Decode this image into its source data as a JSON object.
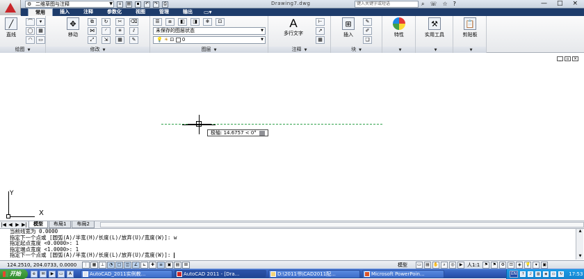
{
  "titlebar": {
    "workspace": "二维草图与注释",
    "doc_title": "Drawing7.dwg",
    "search_placeholder": "键入关键字或短语",
    "qat_icons": [
      "new-icon",
      "open-icon",
      "save-icon",
      "undo-icon",
      "redo-icon",
      "plot-icon"
    ],
    "win_controls": [
      "—",
      "□",
      "×"
    ]
  },
  "tabs": [
    "常用",
    "插入",
    "注释",
    "参数化",
    "视图",
    "管理",
    "输出"
  ],
  "ribbon": {
    "draw": {
      "title": "绘图",
      "line_label": "直线"
    },
    "modify": {
      "title": "修改",
      "move_label": "移动"
    },
    "layers": {
      "title": "图层",
      "layer_state": "未保存的图层状态",
      "layer_current": "0"
    },
    "annotation": {
      "title": "注释",
      "mtext_label": "多行文字",
      "mtext_glyph": "A"
    },
    "block": {
      "title": "块",
      "insert_label": "插入"
    },
    "properties": {
      "title": "特性"
    },
    "utilities": {
      "title": "实用工具"
    },
    "clipboard": {
      "title": "剪贴板"
    }
  },
  "canvas": {
    "tooltip": "极轴: 14.6757 < 0°",
    "ucs_x": "X",
    "ucs_y": "Y"
  },
  "layout_tabs": [
    "模型",
    "布局1",
    "布局2"
  ],
  "command": {
    "lines": [
      "当前线宽为 0.0000",
      "指定下一个点或 [圆弧(A)/半宽(H)/长度(L)/放弃(U)/宽度(W)]: w",
      "指定起点宽度 <0.0000>: 1",
      "指定端点宽度 <1.0000>: 1"
    ],
    "prompt": "指定下一个点或 [圆弧(A)/半宽(H)/长度(L)/放弃(U)/宽度(W)]:"
  },
  "status": {
    "coords": "124.2510, 204.0733, 0.0000",
    "model": "模型",
    "scale": "人1:1"
  },
  "taskbar": {
    "start": "开始",
    "items": [
      "AutoCAD_2011实例教...",
      "AutoCAD 2011 - [Dra...",
      "D:\\2011书\\CAD2011配...",
      "Microsoft PowerPoin..."
    ],
    "lang": "EN",
    "clock": "17:53"
  },
  "colors": {
    "tabbar": "#1e3c6b",
    "track": "#2fa24a",
    "app_logo": "#c9262a",
    "taskbar": "#2c57b4"
  }
}
